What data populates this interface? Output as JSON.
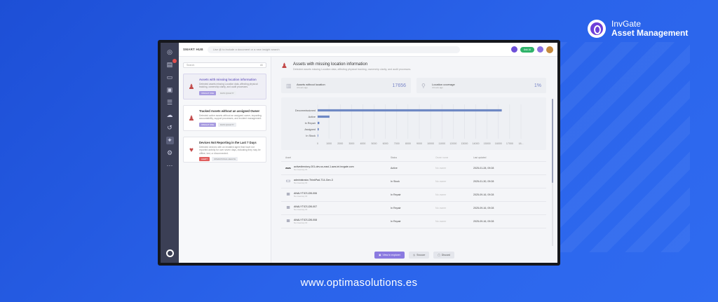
{
  "brand": {
    "line1": "InvGate",
    "line2": "Asset Management"
  },
  "footer_url": "www.optimasolutions.es",
  "topbar": {
    "smart_hub": "SMART HUB",
    "search_placeholder": "Use @ to include a document or a new insight search",
    "pill_label": "Ask AI"
  },
  "left": {
    "search_placeholder": "Search",
    "filter_label": "All",
    "cards": [
      {
        "title": "Assets with missing location information",
        "desc": "Detected assets missing Location data, affecting physical tracking, ownership clarity, and audit processes.",
        "tags": [
          "INSIGHT ONE",
          "DATA QUALITY"
        ]
      },
      {
        "title": "Tracked Assets without an assigned Owner",
        "desc": "Detected active assets without an assigned owner, impacting accountability, support processes, and incident management.",
        "tags": [
          "INSIGHT ONE",
          "DATA QUALITY"
        ]
      },
      {
        "title": "Devices Not Reporting in the Last 7 Days",
        "desc": "Detected devices with an installed agent that have not reported activity for over seven days, indicating they may be offline, lost, or disconnected.",
        "tags": [
          "ALERT",
          "OPERATIONAL HEALTH"
        ]
      }
    ]
  },
  "right": {
    "title": "Assets with missing location information",
    "subtitle": "Detected assets missing Location data, affecting physical tracking, ownership clarity, and audit processes.",
    "stats": [
      {
        "label": "Assets without location",
        "sub": "4 hours ago",
        "value": "17656"
      },
      {
        "label": "Location coverage",
        "sub": "4 hours ago",
        "value": "1%"
      }
    ],
    "table": {
      "headers": [
        "Asset",
        "Status",
        "Owner name",
        "Last updated"
      ],
      "rows": [
        {
          "name": "activedirectory-001-dev.us-east-1.aws.int.invgate.com",
          "sub": "No inventory ID",
          "status": "Active",
          "owner": "No owner",
          "date": "2025-01-28, 09:28",
          "icon": "aws"
        },
        {
          "name": "administrator-ThinkPad-T14-Gen-3",
          "sub": "No inventory ID",
          "status": "In Stock",
          "owner": "No owner",
          "date": "2025-01-30, 09:28",
          "icon": "laptop"
        },
        {
          "name": "ANALYTICS-DB-006",
          "sub": "No inventory ID",
          "status": "In Repair",
          "owner": "No owner",
          "date": "2025-09-16, 09:28",
          "icon": "db"
        },
        {
          "name": "ANALYTICS-DB-007",
          "sub": "No inventory ID",
          "status": "In Repair",
          "owner": "No owner",
          "date": "2025-09-16, 09:28",
          "icon": "db"
        },
        {
          "name": "ANALYTICS-DB-008",
          "sub": "No inventory ID",
          "status": "In Repair",
          "owner": "No owner",
          "date": "2025-09-16, 09:28",
          "icon": "db"
        }
      ]
    },
    "actions": {
      "primary": "View in explorer",
      "secondary": "Snooze",
      "tertiary": "Discard"
    }
  },
  "chart_data": {
    "type": "bar",
    "orientation": "horizontal",
    "categories": [
      "Decommissioned",
      "Active",
      "In Repair",
      "Assigned",
      "In Stock"
    ],
    "values": [
      16300,
      1050,
      150,
      100,
      50
    ],
    "xlim": [
      0,
      18000
    ],
    "xticks": [
      "0",
      "1000",
      "2000",
      "3000",
      "4000",
      "5000",
      "6000",
      "7000",
      "8000",
      "9000",
      "10000",
      "11000",
      "12000",
      "13000",
      "14000",
      "15000",
      "16000",
      "17000",
      "18..."
    ],
    "color": "#6e88c4",
    "grid": true
  }
}
